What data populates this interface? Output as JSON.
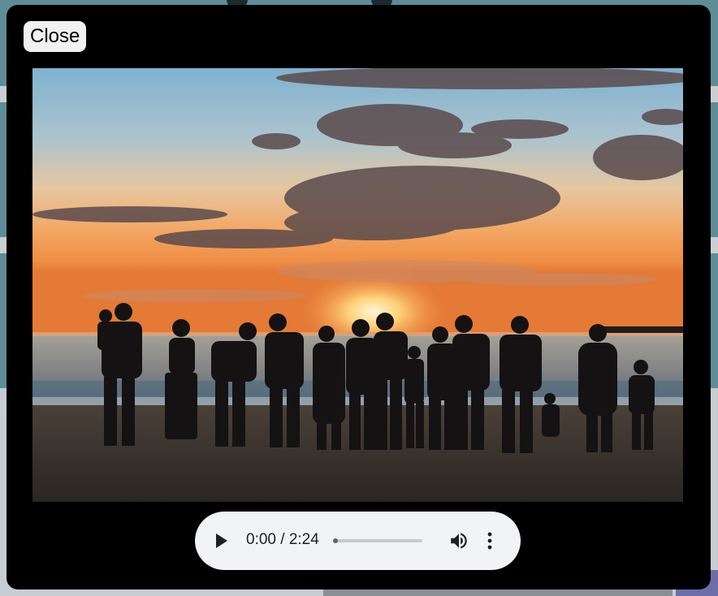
{
  "modal": {
    "close_label": "Close"
  },
  "media": {
    "image_icon": "family-sunset-beach-photo",
    "audio": {
      "current_time": "0:00",
      "duration": "2:24",
      "time_display": "0:00 / 2:24",
      "progress_fraction": 0,
      "icons": {
        "play": "play-icon",
        "volume": "volume-icon",
        "more": "more-options-icon"
      }
    }
  },
  "colors": {
    "modal_background": "#000000",
    "player_background": "#f1f3f4",
    "close_button_background": "#f1f1f1",
    "page_background": "#5e8d97"
  }
}
